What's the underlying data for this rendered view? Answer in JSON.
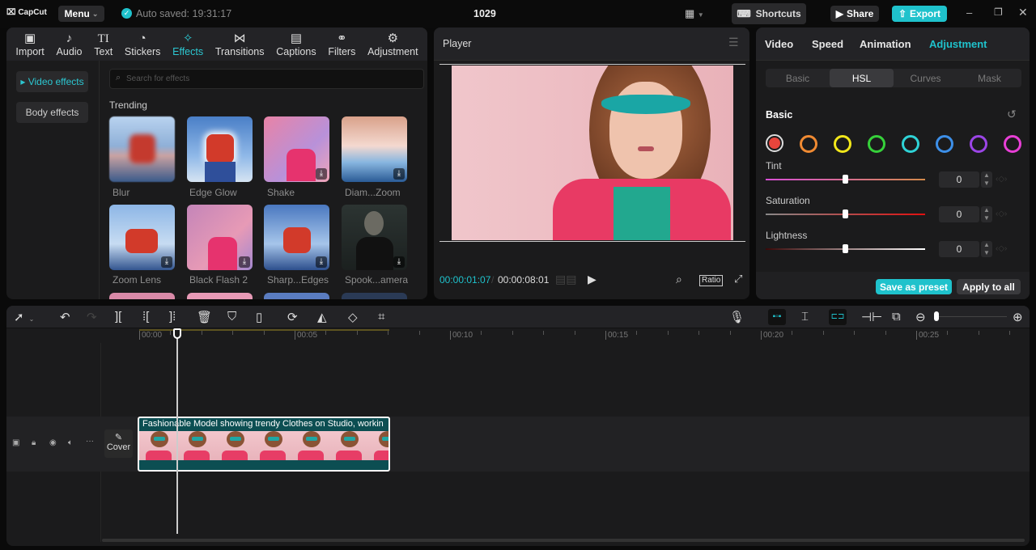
{
  "app": {
    "logo": "CapCut",
    "menu": "Menu",
    "autosave": "Auto saved: 19:31:17",
    "project": "1029",
    "shortcuts": "Shortcuts",
    "share": "Share",
    "export": "Export"
  },
  "media_tabs": [
    {
      "label": "Import",
      "icon": "▣"
    },
    {
      "label": "Audio",
      "icon": "♪"
    },
    {
      "label": "Text",
      "icon": "TI"
    },
    {
      "label": "Stickers",
      "icon": "◔"
    },
    {
      "label": "Effects",
      "icon": "✧"
    },
    {
      "label": "Transitions",
      "icon": "⋈"
    },
    {
      "label": "Captions",
      "icon": "▤"
    },
    {
      "label": "Filters",
      "icon": "⚭"
    },
    {
      "label": "Adjustment",
      "icon": "⚙"
    }
  ],
  "effects": {
    "categories": [
      "Video effects",
      "Body effects"
    ],
    "search_placeholder": "Search for effects",
    "section": "Trending",
    "items": [
      {
        "name": "Blur",
        "download": false
      },
      {
        "name": "Edge Glow",
        "download": false
      },
      {
        "name": "Shake",
        "download": true
      },
      {
        "name": "Diam...Zoom",
        "download": true
      },
      {
        "name": "Zoom Lens",
        "download": true
      },
      {
        "name": "Black Flash 2",
        "download": true
      },
      {
        "name": "Sharp...Edges",
        "download": true
      },
      {
        "name": "Spook...amera",
        "download": true
      }
    ]
  },
  "player": {
    "title": "Player",
    "current_time": "00:00:01:07",
    "total_time": "00:00:08:01",
    "ratio": "Ratio"
  },
  "inspector": {
    "tabs": [
      "Video",
      "Speed",
      "Animation",
      "Adjustment"
    ],
    "active_tab": "Adjustment",
    "subtabs": [
      "Basic",
      "HSL",
      "Curves",
      "Mask"
    ],
    "active_subtab": "HSL",
    "section": "Basic",
    "colors": [
      "#e8453c",
      "#f08a32",
      "#f2e71a",
      "#36d13a",
      "#2fd3d6",
      "#3d8fe8",
      "#9b45e6",
      "#e83fd6"
    ],
    "sliders": [
      {
        "label": "Tint",
        "value": "0",
        "fraction": 0.5
      },
      {
        "label": "Saturation",
        "value": "0",
        "fraction": 0.5
      },
      {
        "label": "Lightness",
        "value": "0",
        "fraction": 0.5
      }
    ],
    "save_preset": "Save as preset",
    "apply_all": "Apply to all"
  },
  "timeline": {
    "ruler": [
      "00:00",
      "00:05",
      "00:10",
      "00:15",
      "00:20",
      "00:25"
    ],
    "cover": "Cover",
    "clip_title": "Fashionable Model showing trendy Clothes on Studio, workin"
  },
  "accent": "#1fc2cc"
}
